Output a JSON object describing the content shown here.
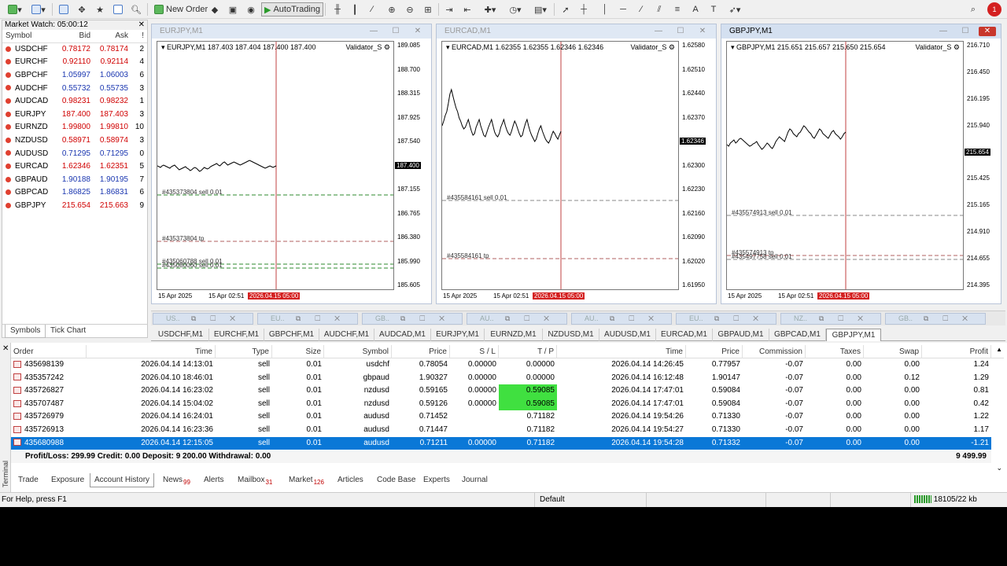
{
  "toolbar": {
    "new_order": "New Order",
    "autotrading": "AutoTrading",
    "notif_count": "1"
  },
  "market_watch": {
    "title": "Market Watch: 05:00:12",
    "columns": [
      "Symbol",
      "Bid",
      "Ask",
      "!"
    ],
    "rows": [
      {
        "symbol": "USDCHF",
        "bid": "0.78172",
        "ask": "0.78174",
        "spread": "2",
        "bid_color": "red"
      },
      {
        "symbol": "EURCHF",
        "bid": "0.92110",
        "ask": "0.92114",
        "spread": "4",
        "bid_color": "red"
      },
      {
        "symbol": "GBPCHF",
        "bid": "1.05997",
        "ask": "1.06003",
        "spread": "6",
        "bid_color": "blue"
      },
      {
        "symbol": "AUDCHF",
        "bid": "0.55732",
        "ask": "0.55735",
        "spread": "3",
        "bid_color": "blue"
      },
      {
        "symbol": "AUDCAD",
        "bid": "0.98231",
        "ask": "0.98232",
        "spread": "1",
        "bid_color": "red"
      },
      {
        "symbol": "EURJPY",
        "bid": "187.400",
        "ask": "187.403",
        "spread": "3",
        "bid_color": "red"
      },
      {
        "symbol": "EURNZD",
        "bid": "1.99800",
        "ask": "1.99810",
        "spread": "10",
        "bid_color": "red"
      },
      {
        "symbol": "NZDUSD",
        "bid": "0.58971",
        "ask": "0.58974",
        "spread": "3",
        "bid_color": "red"
      },
      {
        "symbol": "AUDUSD",
        "bid": "0.71295",
        "ask": "0.71295",
        "spread": "0",
        "bid_color": "blue"
      },
      {
        "symbol": "EURCAD",
        "bid": "1.62346",
        "ask": "1.62351",
        "spread": "5",
        "bid_color": "red"
      },
      {
        "symbol": "GBPAUD",
        "bid": "1.90188",
        "ask": "1.90195",
        "spread": "7",
        "bid_color": "blue"
      },
      {
        "symbol": "GBPCAD",
        "bid": "1.86825",
        "ask": "1.86831",
        "spread": "6",
        "bid_color": "blue"
      },
      {
        "symbol": "GBPJPY",
        "bid": "215.654",
        "ask": "215.663",
        "spread": "9",
        "bid_color": "red"
      }
    ],
    "tabs": [
      "Symbols",
      "Tick Chart"
    ]
  },
  "charts": [
    {
      "title": "EURJPY,M1",
      "info": "EURJPY,M1  187.403 187.404 187.400 187.400",
      "indicator": "Validator_S",
      "y_labels": [
        "189.085",
        "188.700",
        "188.315",
        "187.925",
        "187.540",
        "187.400",
        "187.155",
        "186.765",
        "186.380",
        "185.990",
        "185.605"
      ],
      "x_labels": [
        "15 Apr 2025",
        "15 Apr 02:51",
        "2026.04.15 05:00"
      ],
      "orders": [
        "#435373804 sell 0.01",
        "#435373804 tp",
        "#435060788 sell 0.01",
        "#435080060 sell 0.01"
      ],
      "series": [
        209,
        210,
        211,
        209,
        208,
        209,
        210,
        211,
        212,
        210,
        209,
        208,
        210,
        212,
        214,
        213,
        212,
        211,
        210,
        212,
        213,
        215,
        214,
        212,
        211,
        212,
        214,
        216,
        215,
        213,
        211,
        212,
        213,
        212,
        210,
        209,
        208,
        207,
        206,
        208,
        209,
        207,
        205,
        204,
        206,
        208,
        207,
        206,
        205,
        204,
        205,
        206,
        207,
        208,
        207,
        206,
        205,
        204,
        203,
        202,
        203,
        204,
        205,
        206,
        207,
        208,
        209,
        210,
        211,
        212,
        211,
        210,
        209,
        210,
        211,
        210,
        209
      ]
    },
    {
      "title": "EURCAD,M1",
      "info": "EURCAD,M1  1.62355 1.62355 1.62346 1.62346",
      "indicator": "Validator_S",
      "y_labels": [
        "1.62580",
        "1.62510",
        "1.62440",
        "1.62370",
        "1.62346",
        "1.62300",
        "1.62230",
        "1.62160",
        "1.62090",
        "1.62020",
        "1.61950"
      ],
      "x_labels": [
        "15 Apr 2025",
        "15 Apr 02:51",
        "2026.04.15 05:00"
      ],
      "orders": [
        "#435584161 sell 0.01",
        "#435584161 tp"
      ],
      "series": [
        158,
        152,
        145,
        140,
        130,
        118,
        112,
        120,
        128,
        135,
        140,
        148,
        152,
        158,
        162,
        160,
        155,
        150,
        158,
        165,
        170,
        168,
        160,
        155,
        150,
        158,
        164,
        170,
        172,
        166,
        160,
        155,
        150,
        158,
        166,
        170,
        172,
        168,
        160,
        155,
        150,
        158,
        164,
        168,
        170,
        165,
        158,
        152,
        156,
        162,
        168,
        172,
        170,
        162,
        155,
        150,
        158,
        165,
        170,
        174,
        178,
        175,
        168,
        162,
        158,
        165,
        170,
        175,
        178,
        180,
        176,
        170,
        165,
        168,
        172,
        175,
        170,
        165
      ]
    },
    {
      "title": "GBPJPY,M1",
      "info": "GBPJPY,M1  215.651 215.657 215.650 215.654",
      "indicator": "Validator_S",
      "y_labels": [
        "216.710",
        "216.450",
        "216.195",
        "215.940",
        "215.654",
        "215.425",
        "215.165",
        "214.910",
        "214.655",
        "214.395"
      ],
      "x_labels": [
        "15 Apr 2025",
        "15 Apr 02:51",
        "2026.04.15 05:00"
      ],
      "orders": [
        "#435574913 sell 0.01",
        "#435574913 tp",
        "#435497758 sell 0.01"
      ],
      "series": [
        182,
        184,
        180,
        178,
        176,
        180,
        178,
        175,
        174,
        176,
        178,
        180,
        182,
        184,
        183,
        181,
        180,
        178,
        182,
        185,
        188,
        186,
        183,
        180,
        182,
        185,
        187,
        183,
        178,
        175,
        172,
        174,
        176,
        178,
        172,
        166,
        162,
        164,
        168,
        170,
        172,
        168,
        166,
        162,
        158,
        160,
        163,
        166,
        168,
        172,
        174,
        170,
        166,
        162,
        164,
        168,
        170,
        172,
        174,
        170,
        166,
        164,
        168,
        170,
        172,
        175,
        172,
        168,
        166
      ]
    }
  ],
  "mini_windows": [
    "US..",
    "EU..",
    "GB..",
    "AU..",
    "AU..",
    "EU..",
    "NZ..",
    "GB.."
  ],
  "symbol_tabs": [
    "USDCHF,M1",
    "EURCHF,M1",
    "GBPCHF,M1",
    "AUDCHF,M1",
    "AUDCAD,M1",
    "EURJPY,M1",
    "EURNZD,M1",
    "NZDUSD,M1",
    "AUDUSD,M1",
    "EURCAD,M1",
    "GBPAUD,M1",
    "GBPCAD,M1",
    "GBPJPY,M1"
  ],
  "history": {
    "columns": [
      "Order",
      "Time",
      "Type",
      "Size",
      "Symbol",
      "Price",
      "S / L",
      "T / P",
      "Time",
      "Price",
      "Commission",
      "Taxes",
      "Swap",
      "Profit"
    ],
    "rows": [
      {
        "order": "435698139",
        "time": "2026.04.14 14:13:01",
        "type": "sell",
        "size": "0.01",
        "symbol": "usdchf",
        "price": "0.78054",
        "sl": "0.00000",
        "tp": "0.00000",
        "ctime": "2026.04.14 14:26:45",
        "cprice": "0.77957",
        "comm": "-0.07",
        "taxes": "0.00",
        "swap": "0.00",
        "profit": "1.24",
        "tp_hl": false,
        "sel": false
      },
      {
        "order": "435357242",
        "time": "2026.04.10 18:46:01",
        "type": "sell",
        "size": "0.01",
        "symbol": "gbpaud",
        "price": "1.90327",
        "sl": "0.00000",
        "tp": "0.00000",
        "ctime": "2026.04.14 16:12:48",
        "cprice": "1.90147",
        "comm": "-0.07",
        "taxes": "0.00",
        "swap": "0.12",
        "profit": "1.29",
        "tp_hl": false,
        "sel": false
      },
      {
        "order": "435726827",
        "time": "2026.04.14 16:23:02",
        "type": "sell",
        "size": "0.01",
        "symbol": "nzdusd",
        "price": "0.59165",
        "sl": "0.00000",
        "tp": "0.59085",
        "ctime": "2026.04.14 17:47:01",
        "cprice": "0.59084",
        "comm": "-0.07",
        "taxes": "0.00",
        "swap": "0.00",
        "profit": "0.81",
        "tp_hl": true,
        "sel": false
      },
      {
        "order": "435707487",
        "time": "2026.04.14 15:04:02",
        "type": "sell",
        "size": "0.01",
        "symbol": "nzdusd",
        "price": "0.59126",
        "sl": "0.00000",
        "tp": "0.59085",
        "ctime": "2026.04.14 17:47:01",
        "cprice": "0.59084",
        "comm": "-0.07",
        "taxes": "0.00",
        "swap": "0.00",
        "profit": "0.42",
        "tp_hl": true,
        "sel": false
      },
      {
        "order": "435726979",
        "time": "2026.04.14 16:24:01",
        "type": "sell",
        "size": "0.01",
        "symbol": "audusd",
        "price": "0.71452",
        "sl": "",
        "tp": "0.71182",
        "ctime": "2026.04.14 19:54:26",
        "cprice": "0.71330",
        "comm": "-0.07",
        "taxes": "0.00",
        "swap": "0.00",
        "profit": "1.22",
        "tp_hl": false,
        "sel": false
      },
      {
        "order": "435726913",
        "time": "2026.04.14 16:23:36",
        "type": "sell",
        "size": "0.01",
        "symbol": "audusd",
        "price": "0.71447",
        "sl": "",
        "tp": "0.71182",
        "ctime": "2026.04.14 19:54:27",
        "cprice": "0.71330",
        "comm": "-0.07",
        "taxes": "0.00",
        "swap": "0.00",
        "profit": "1.17",
        "tp_hl": false,
        "sel": false
      },
      {
        "order": "435680988",
        "time": "2026.04.14 12:15:05",
        "type": "sell",
        "size": "0.01",
        "symbol": "audusd",
        "price": "0.71211",
        "sl": "0.00000",
        "tp": "0.71182",
        "ctime": "2026.04.14 19:54:28",
        "cprice": "0.71332",
        "comm": "-0.07",
        "taxes": "0.00",
        "swap": "0.00",
        "profit": "-1.21",
        "tp_hl": false,
        "sel": true
      }
    ],
    "summary": "Profit/Loss: 299.99  Credit: 0.00  Deposit: 9 200.00  Withdrawal: 0.00",
    "total": "9 499.99"
  },
  "terminal_tabs": [
    {
      "label": "Trade",
      "count": ""
    },
    {
      "label": "Exposure",
      "count": ""
    },
    {
      "label": "Account History",
      "count": ""
    },
    {
      "label": "News",
      "count": "99"
    },
    {
      "label": "Alerts",
      "count": ""
    },
    {
      "label": "Mailbox",
      "count": "31"
    },
    {
      "label": "Market",
      "count": "126"
    },
    {
      "label": "Articles",
      "count": ""
    },
    {
      "label": "Code Base",
      "count": ""
    },
    {
      "label": "Experts",
      "count": ""
    },
    {
      "label": "Journal",
      "count": ""
    }
  ],
  "terminal_label": "Terminal",
  "status": {
    "help": "For Help, press F1",
    "profile": "Default",
    "traffic": "18105/22 kb"
  }
}
